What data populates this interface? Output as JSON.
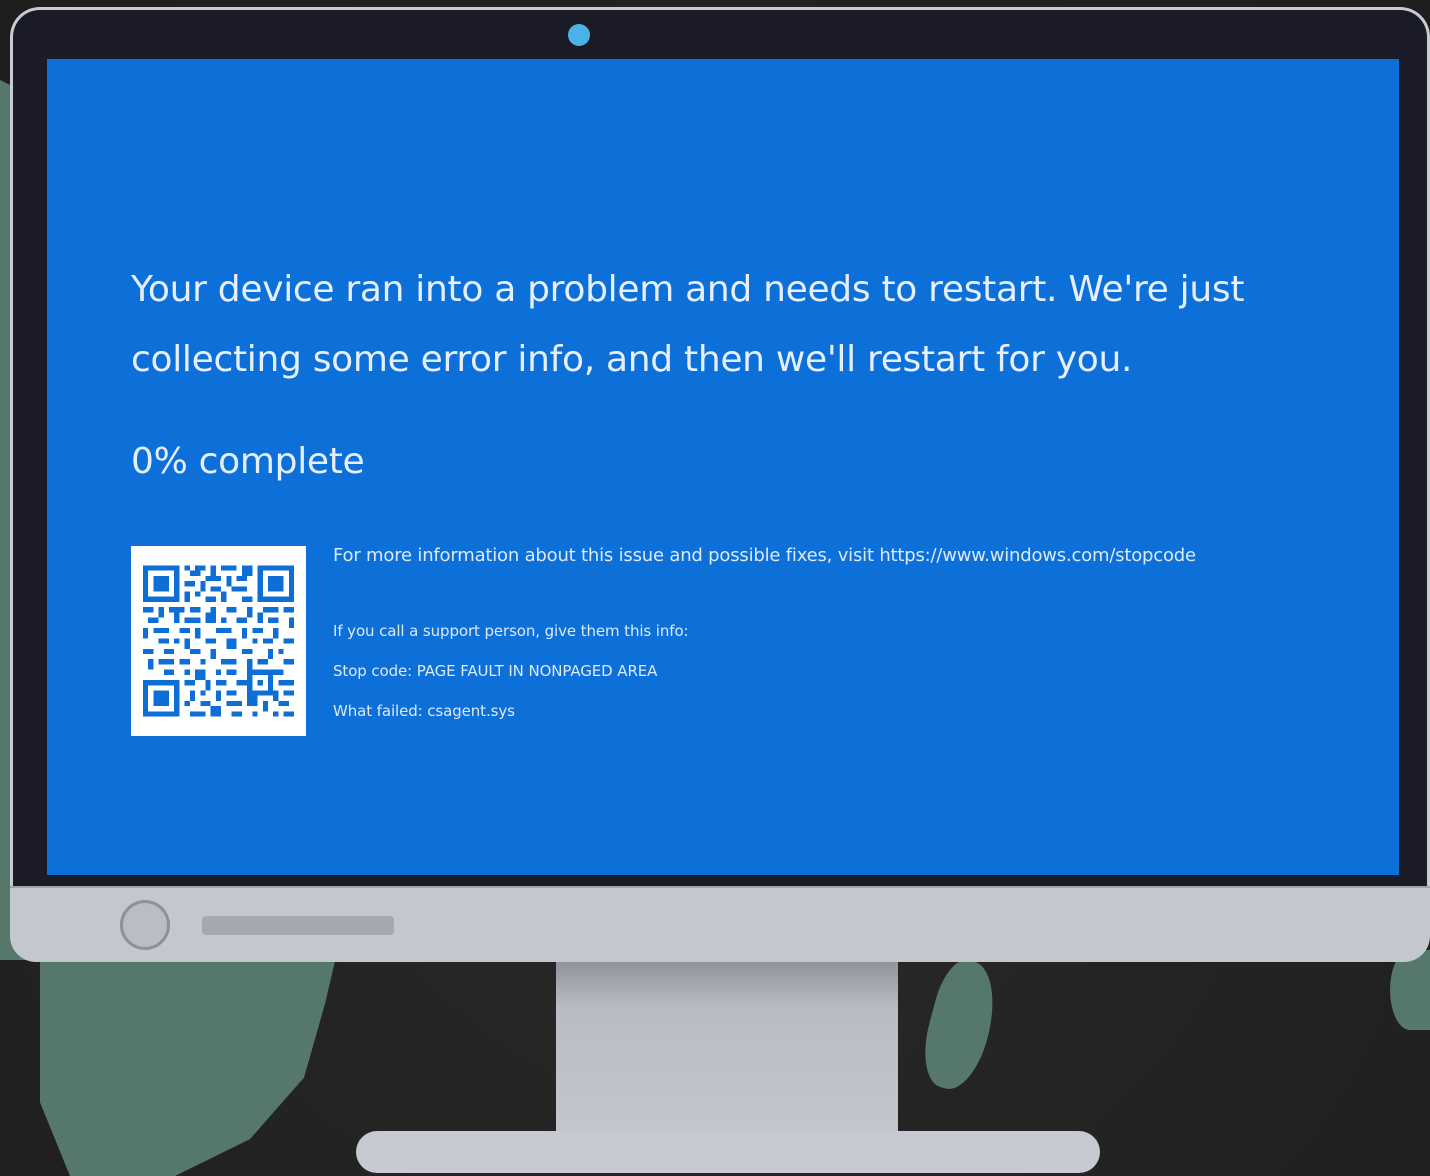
{
  "bsod": {
    "message": "Your device ran into a problem and needs to restart. We're just collecting some error info, and then we'll restart for you.",
    "progress": 0.0,
    "progress_text": "0% complete",
    "more_info": "For more information about this issue and possible fixes, visit https://www.windows.com/stopcode",
    "support_prompt": "If you call a support person, give them this info:",
    "stop_code": "Stop code: PAGE FAULT IN NONPAGED AREA",
    "what_failed": "What failed: csagent.sys"
  },
  "colors": {
    "screen_background": "#0d70d8",
    "screen_text": "#e6efff",
    "monitor_bezel": "#1b1b27",
    "monitor_chin": "#c3c7ce",
    "webcam": "#4ab3e6",
    "backdrop": "#222222",
    "map": "#56786a"
  },
  "icons": {
    "qr_code": "qr-code-icon",
    "webcam": "webcam-icon",
    "power_button": "power-button-icon"
  }
}
